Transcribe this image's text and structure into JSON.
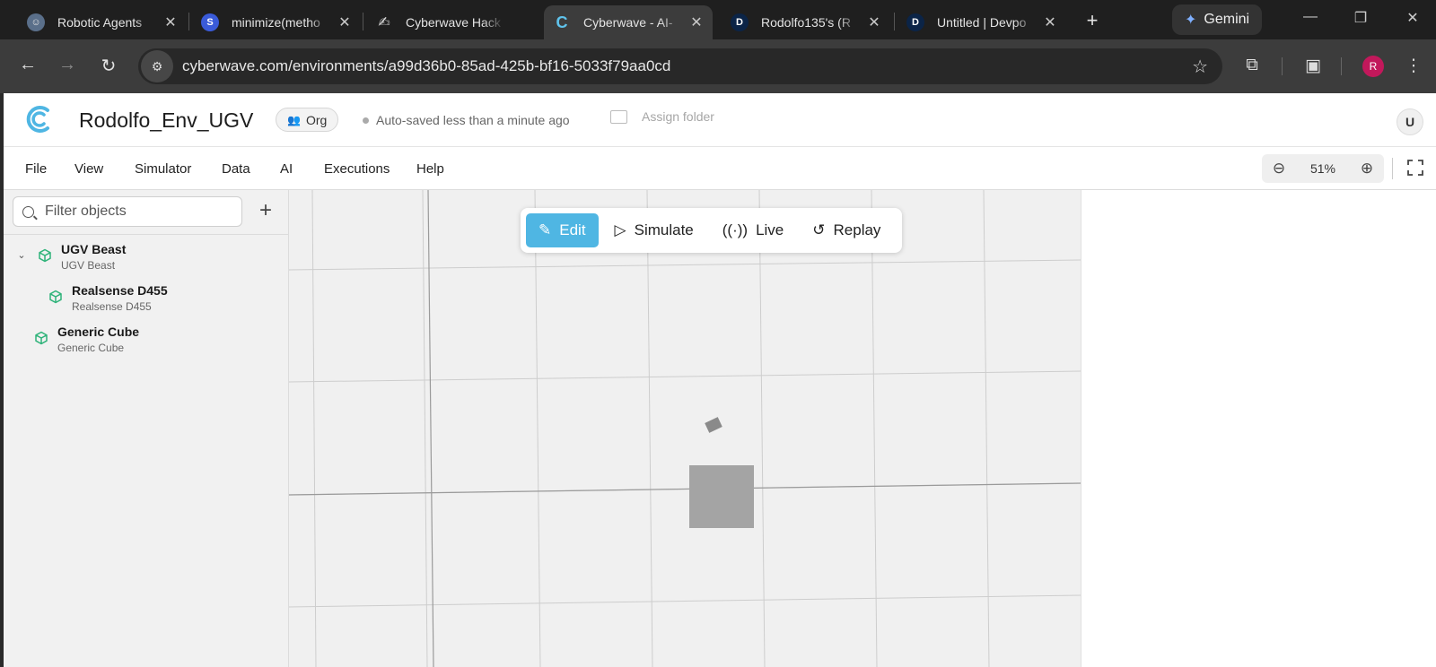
{
  "browser": {
    "tabs": [
      {
        "title": "Robotic Agents",
        "favicon": "robot-icon",
        "active": false
      },
      {
        "title": "minimize(metho",
        "favicon": "s-icon",
        "active": false
      },
      {
        "title": "Cyberwave Hack",
        "favicon": "arm-icon",
        "active": false
      },
      {
        "title": "Cyberwave - AI-",
        "favicon": "cyberwave-icon",
        "active": true
      },
      {
        "title": "Rodolfo135's (R",
        "favicon": "d-icon",
        "active": false
      },
      {
        "title": "Untitled | Devpo",
        "favicon": "d-icon",
        "active": false
      }
    ],
    "gemini_label": "Gemini",
    "url": "cyberwave.com/environments/a99d36b0-85ad-425b-bf16-5033f79aa0cd",
    "profile_initial": "R"
  },
  "header": {
    "env_name": "Rodolfo_Env_UGV",
    "org_label": "Org",
    "autosave": "Auto-saved less than a minute ago",
    "assign_folder": "Assign folder",
    "user_initial": "U"
  },
  "menu": {
    "items": [
      "File",
      "View",
      "Simulator",
      "Data",
      "AI",
      "Executions",
      "Help"
    ],
    "zoom": "51%"
  },
  "sidebar": {
    "filter_placeholder": "Filter objects",
    "tree": [
      {
        "name": "UGV Beast",
        "type": "UGV Beast",
        "expanded": true,
        "level": 0
      },
      {
        "name": "Realsense D455",
        "type": "Realsense D455",
        "level": 1
      },
      {
        "name": "Generic Cube",
        "type": "Generic Cube",
        "level": 0
      }
    ]
  },
  "modes": {
    "edit": "Edit",
    "simulate": "Simulate",
    "live": "Live",
    "replay": "Replay"
  },
  "colors": {
    "accent": "#4fb6e3",
    "cube_icon": "#2fb37a"
  }
}
